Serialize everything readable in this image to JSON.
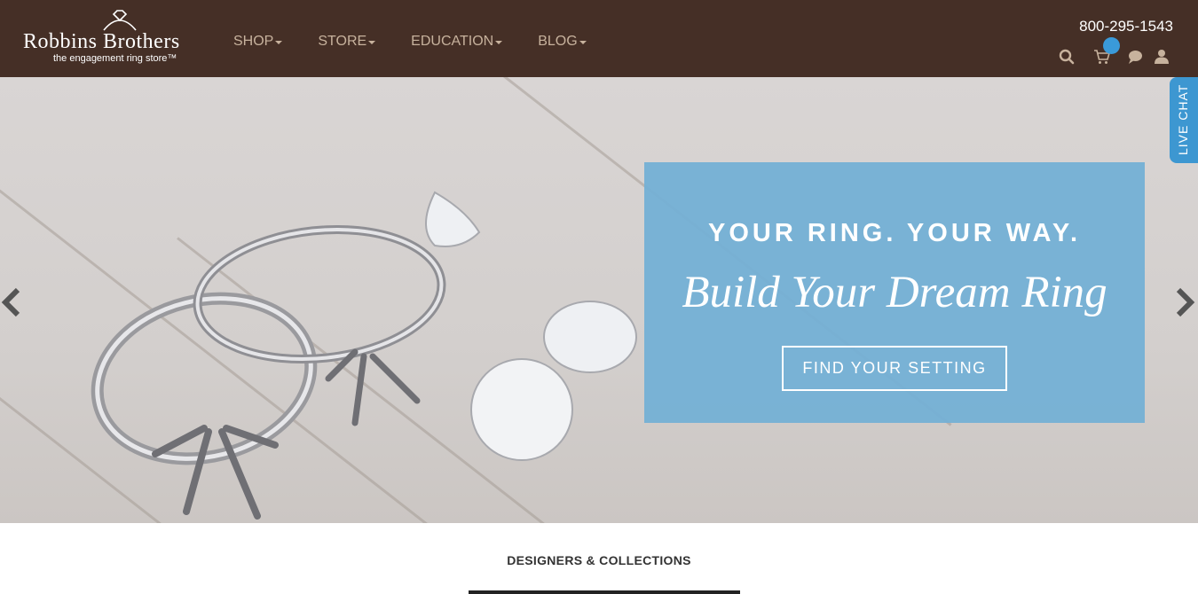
{
  "header": {
    "logo": {
      "name": "Robbins Brothers",
      "tagline": "the engagement ring store™"
    },
    "nav": [
      {
        "label": "SHOP"
      },
      {
        "label": "STORE"
      },
      {
        "label": "EDUCATION"
      },
      {
        "label": "BLOG"
      }
    ],
    "phone": "800-295-1543",
    "icons": [
      "search-icon",
      "cart-icon",
      "chat-bubble-icon",
      "user-icon"
    ],
    "colors": {
      "background": "#452f26",
      "nav_text": "#c7b29d",
      "cart_badge": "#3a9ad9"
    }
  },
  "hero": {
    "headline": "YOUR RING. YOUR WAY.",
    "subheadline": "Build Your Dream Ring",
    "cta": "FIND YOUR SETTING",
    "colors": {
      "promo_box": "#74b0d5"
    }
  },
  "live_chat": {
    "label": "LIVE CHAT",
    "color": "#3d97d1"
  },
  "section": {
    "title": "DESIGNERS & COLLECTIONS"
  }
}
